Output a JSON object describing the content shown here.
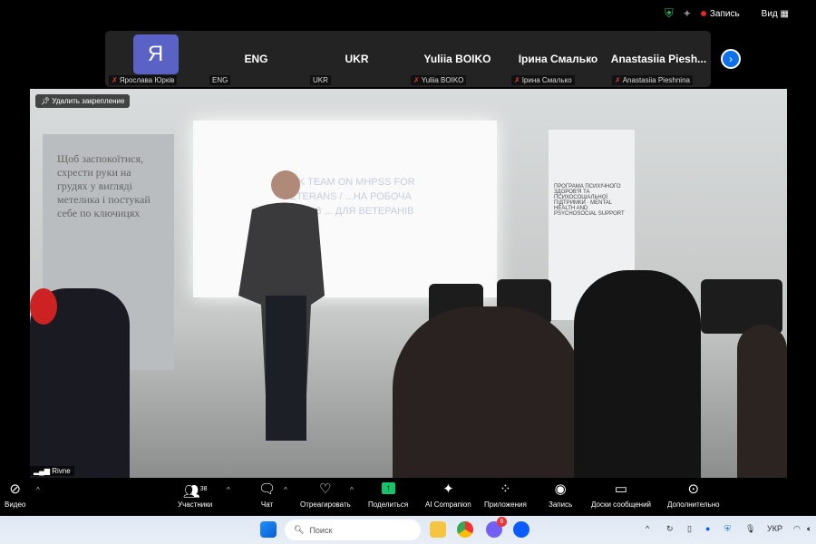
{
  "top": {
    "record_label": "Запись",
    "view_label": "Вид",
    "colors": {
      "shield": "#22c55e",
      "record": "#e02828"
    }
  },
  "participants_strip": [
    {
      "tile_text": "Я",
      "label": "Ярослава Юрків",
      "muted": true,
      "avatar_color": "#5b62c6"
    },
    {
      "tile_text": "ENG",
      "label": "ENG",
      "muted": false
    },
    {
      "tile_text": "UKR",
      "label": "UKR",
      "muted": false
    },
    {
      "tile_text": "Yuliia BOIKO",
      "label": "Yuliia BOIKO",
      "muted": true
    },
    {
      "tile_text": "Ірина Смалько",
      "label": "Ірина Смалько",
      "muted": true
    },
    {
      "tile_text": "Anastasiia Piesh...",
      "label": "Anastasiia Pieshnina",
      "muted": true
    }
  ],
  "video": {
    "unpin_label": "Удалить закрепление",
    "network_label": "Rivne",
    "slide_text": "TASK TEAM ON MHPSS FOR VETERANS / ...НА РОБОЧА ГРУПА З ... ДЛЯ ВЕТЕРАНІВ",
    "banner_left": "Щоб заспокоїтися, схрести руки на грудях у вигляді метелика і постукай себе по ключицях",
    "banner_right": "ПРОГРАМА ПСИХІЧНОГО ЗДОРОВ'Я ТА ПСИХОСОЦІАЛЬНОЇ ПІДТРИМКИ · MENTAL HEALTH AND PSYCHOSOCIAL SUPPORT"
  },
  "toolbar": {
    "video": "Видео",
    "participants": "Участники",
    "participants_count": "38",
    "chat": "Чат",
    "react": "Отреагировать",
    "share": "Поделиться",
    "ai": "AI Companion",
    "apps": "Приложения",
    "record": "Запись",
    "whiteboards": "Доски сообщений",
    "more": "Дополнительно",
    "share_color": "#18c26b"
  },
  "taskbar": {
    "search_placeholder": "Поиск",
    "viber_badge": "6",
    "language": "УКР"
  }
}
